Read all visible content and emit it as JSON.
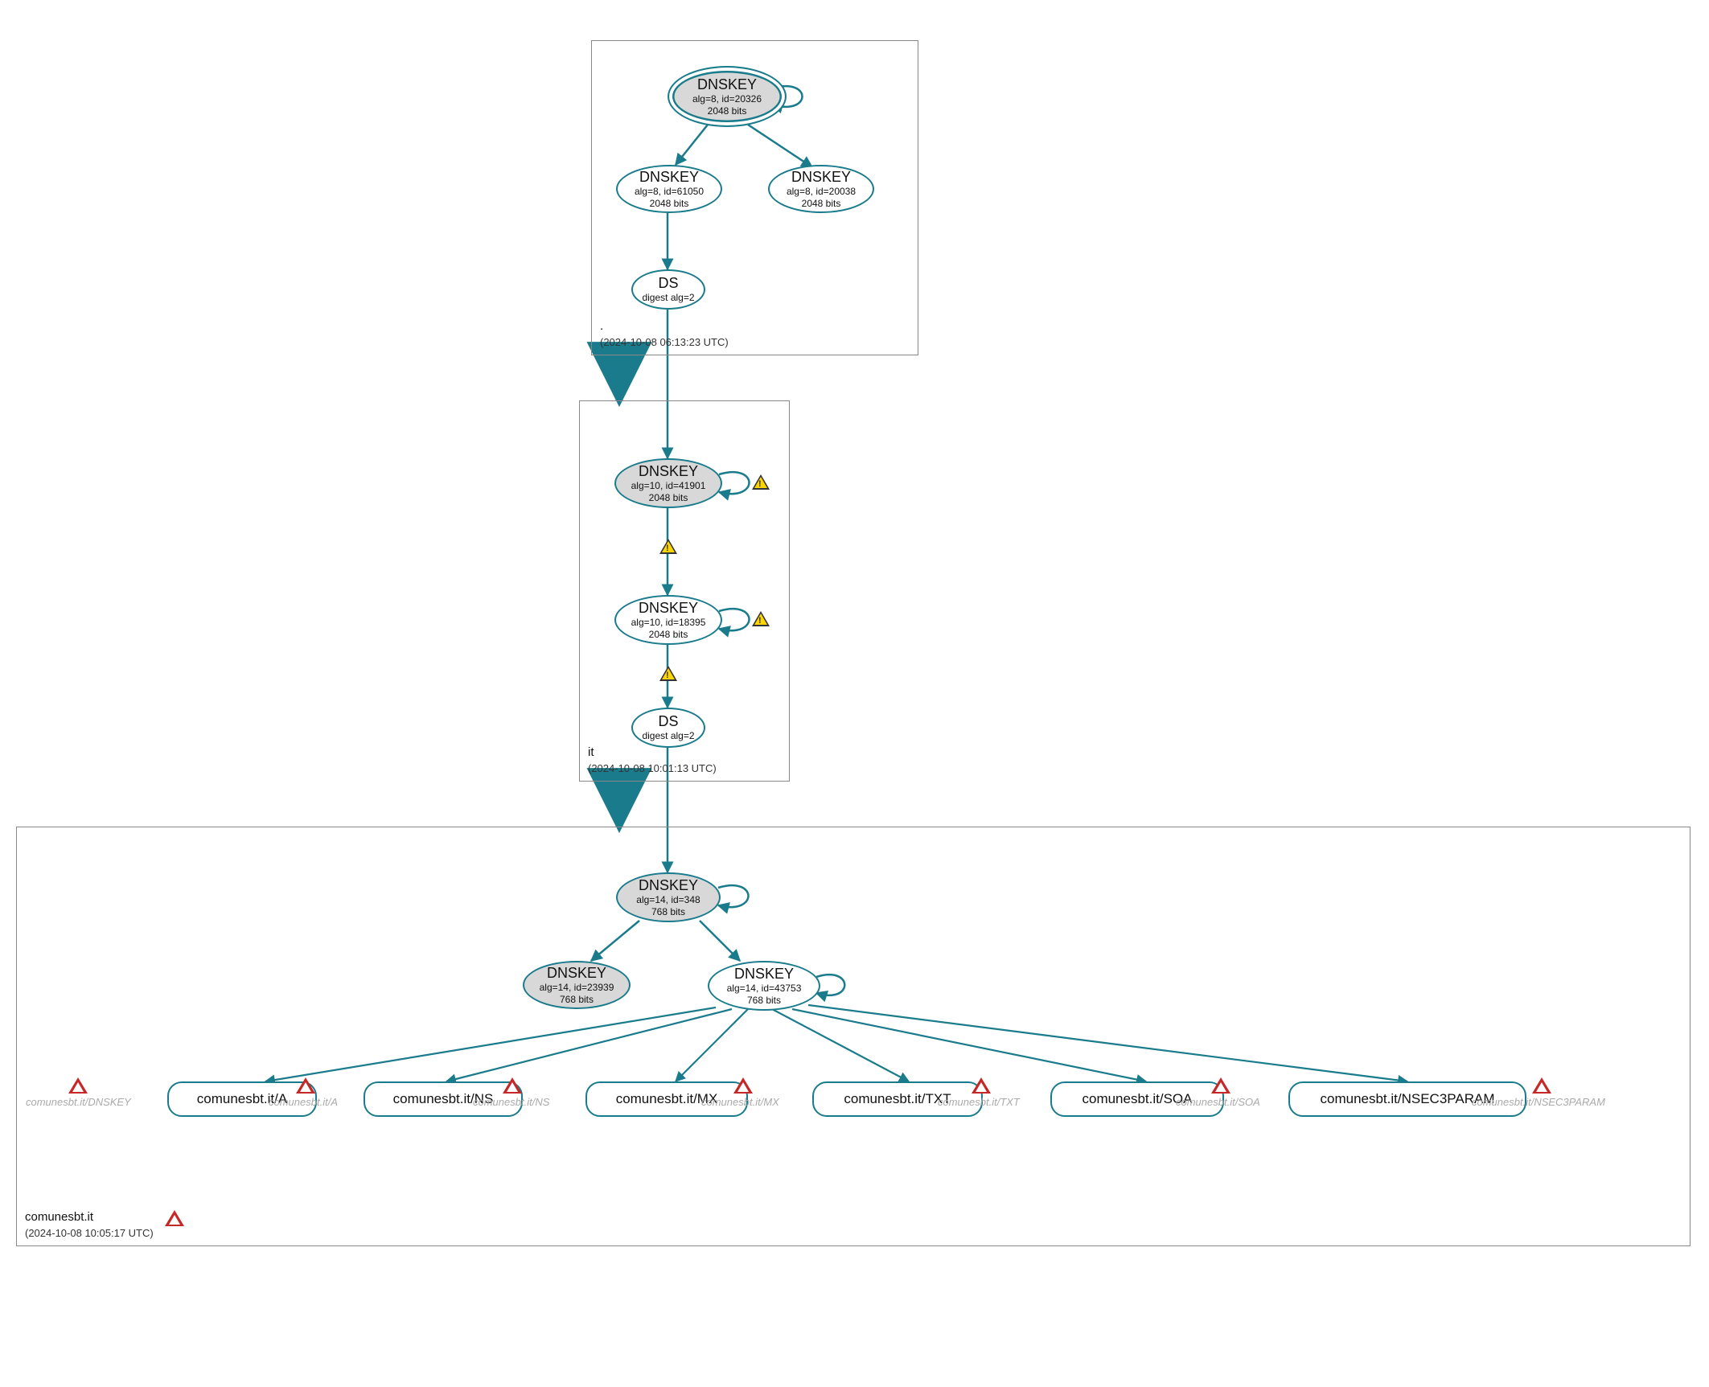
{
  "zones": {
    "root": {
      "name": ".",
      "timestamp": "(2024-10-08 06:13:23 UTC)"
    },
    "it": {
      "name": "it",
      "timestamp": "(2024-10-08 10:01:13 UTC)"
    },
    "leaf": {
      "name": "comunesbt.it",
      "timestamp": "(2024-10-08 10:05:17 UTC)"
    }
  },
  "nodes": {
    "root_ksk": {
      "title": "DNSKEY",
      "sub1": "alg=8, id=20326",
      "sub2": "2048 bits"
    },
    "root_zsk1": {
      "title": "DNSKEY",
      "sub1": "alg=8, id=61050",
      "sub2": "2048 bits"
    },
    "root_zsk2": {
      "title": "DNSKEY",
      "sub1": "alg=8, id=20038",
      "sub2": "2048 bits"
    },
    "root_ds": {
      "title": "DS",
      "sub1": "digest alg=2"
    },
    "it_ksk": {
      "title": "DNSKEY",
      "sub1": "alg=10, id=41901",
      "sub2": "2048 bits"
    },
    "it_zsk": {
      "title": "DNSKEY",
      "sub1": "alg=10, id=18395",
      "sub2": "2048 bits"
    },
    "it_ds": {
      "title": "DS",
      "sub1": "digest alg=2"
    },
    "leaf_ksk": {
      "title": "DNSKEY",
      "sub1": "alg=14, id=348",
      "sub2": "768 bits"
    },
    "leaf_zsk1": {
      "title": "DNSKEY",
      "sub1": "alg=14, id=23939",
      "sub2": "768 bits"
    },
    "leaf_zsk2": {
      "title": "DNSKEY",
      "sub1": "alg=14, id=43753",
      "sub2": "768 bits"
    }
  },
  "rrsets": {
    "a": "comunesbt.it/A",
    "ns": "comunesbt.it/NS",
    "mx": "comunesbt.it/MX",
    "txt": "comunesbt.it/TXT",
    "soa": "comunesbt.it/SOA",
    "nsec": "comunesbt.it/NSEC3PARAM"
  },
  "ghosts": {
    "dnskey": "comunesbt.it/DNSKEY",
    "a": "comunesbt.it/A",
    "ns": "comunesbt.it/NS",
    "mx": "comunesbt.it/MX",
    "txt": "comunesbt.it/TXT",
    "soa": "comunesbt.it/SOA",
    "nsec": "comunesbt.it/NSEC3PARAM"
  },
  "colors": {
    "stroke": "#1a7b8c"
  }
}
